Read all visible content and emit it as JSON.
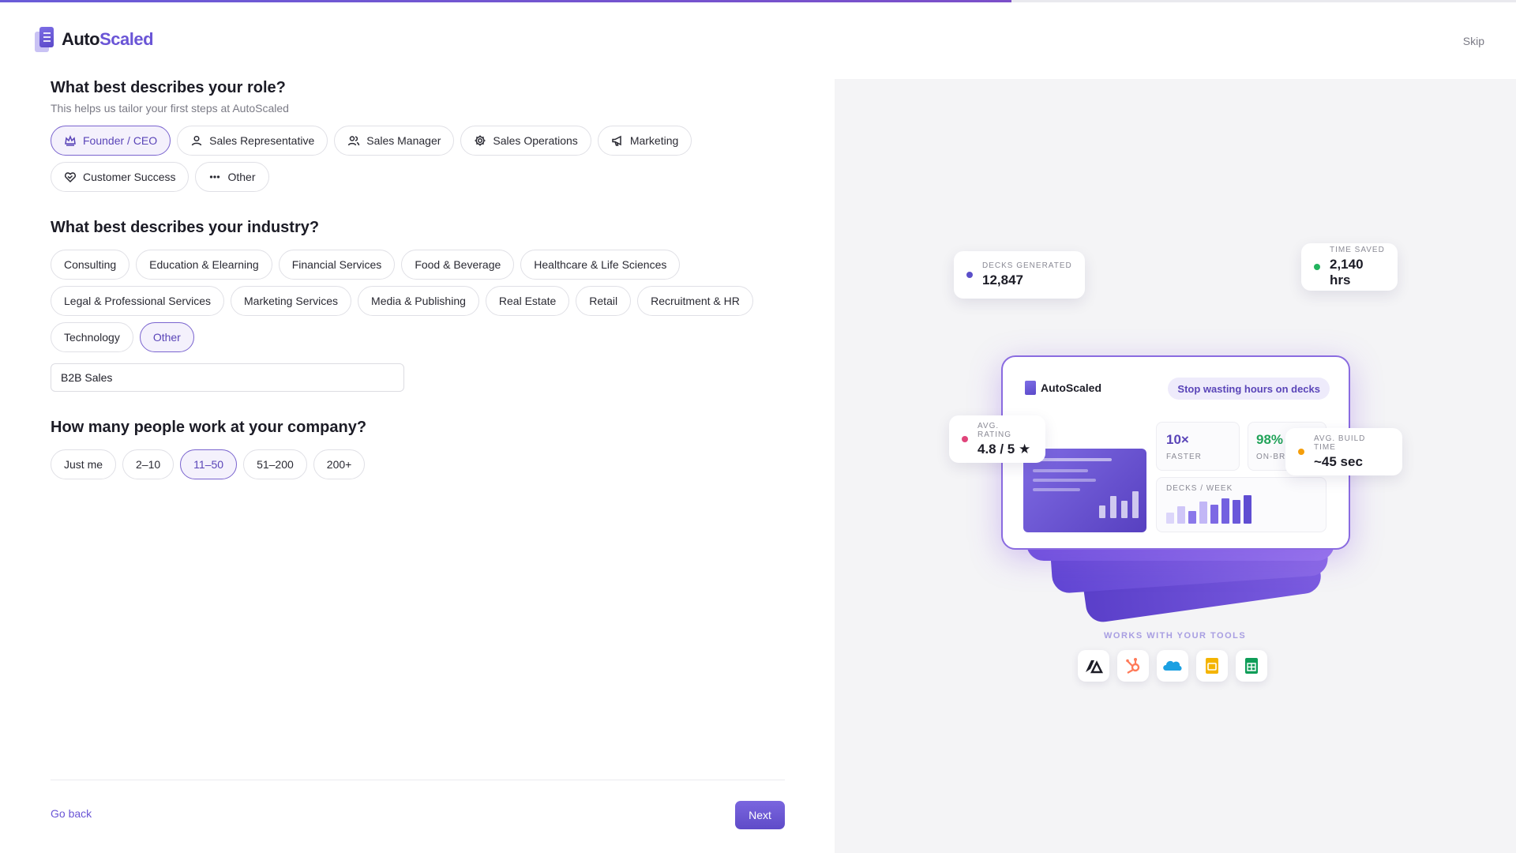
{
  "progress": 0.667,
  "brand": {
    "name_part1": "Auto",
    "name_part2": "Scaled"
  },
  "header": {
    "skip_label": "Skip"
  },
  "role": {
    "title": "What best describes your role?",
    "subtitle": "This helps us tailor your first steps at AutoScaled",
    "options": [
      {
        "label": "Founder / CEO",
        "icon": "crown-icon",
        "selected": true
      },
      {
        "label": "Sales Representative",
        "icon": "user-icon",
        "selected": false
      },
      {
        "label": "Sales Manager",
        "icon": "users-icon",
        "selected": false
      },
      {
        "label": "Sales Operations",
        "icon": "gear-icon",
        "selected": false
      },
      {
        "label": "Marketing",
        "icon": "megaphone-icon",
        "selected": false
      },
      {
        "label": "Customer Success",
        "icon": "heart-handshake-icon",
        "selected": false
      },
      {
        "label": "Other",
        "icon": "more-icon",
        "selected": false
      }
    ]
  },
  "industry": {
    "title": "What best describes your industry?",
    "options": [
      {
        "label": "Consulting",
        "selected": false
      },
      {
        "label": "Education & Elearning",
        "selected": false
      },
      {
        "label": "Financial Services",
        "selected": false
      },
      {
        "label": "Food & Beverage",
        "selected": false
      },
      {
        "label": "Healthcare & Life Sciences",
        "selected": false
      },
      {
        "label": "Legal & Professional Services",
        "selected": false
      },
      {
        "label": "Marketing Services",
        "selected": false
      },
      {
        "label": "Media & Publishing",
        "selected": false
      },
      {
        "label": "Real Estate",
        "selected": false
      },
      {
        "label": "Retail",
        "selected": false
      },
      {
        "label": "Recruitment & HR",
        "selected": false
      },
      {
        "label": "Technology",
        "selected": false
      },
      {
        "label": "Other",
        "selected": true
      }
    ],
    "other_value": "B2B Sales"
  },
  "company_size": {
    "title": "How many people work at your company?",
    "options": [
      {
        "label": "Just me",
        "selected": false
      },
      {
        "label": "2–10",
        "selected": false
      },
      {
        "label": "11–50",
        "selected": true
      },
      {
        "label": "51–200",
        "selected": false
      },
      {
        "label": "200+",
        "selected": false
      }
    ]
  },
  "footer": {
    "back_label": "Go back",
    "next_label": "Next"
  },
  "illustration": {
    "decks_generated": {
      "label": "DECKS GENERATED",
      "value": "12,847",
      "color": "#5b4fc9"
    },
    "time_saved": {
      "label": "TIME SAVED",
      "value": "2,140 hrs",
      "color": "#22b35e"
    },
    "avg_rating": {
      "label": "AVG. RATING",
      "value": "4.8 / 5 ★",
      "color": "#e0457b"
    },
    "avg_build_time": {
      "label": "AVG. BUILD TIME",
      "value": "~45 sec",
      "color": "#f59e0b"
    },
    "card_brand": "AutoScaled",
    "card_tagline": "Stop wasting hours on decks",
    "speed_value": "10×",
    "speed_label": "FASTER",
    "onbrand_value": "98%",
    "onbrand_label": "ON-BRA",
    "decks_week_label": "DECKS / WEEK",
    "tools_label": "WORKS WITH YOUR TOOLS",
    "tools": [
      "autoscaled-icon",
      "hubspot-icon",
      "salesforce-icon",
      "google-slides-icon",
      "google-sheets-icon"
    ]
  }
}
